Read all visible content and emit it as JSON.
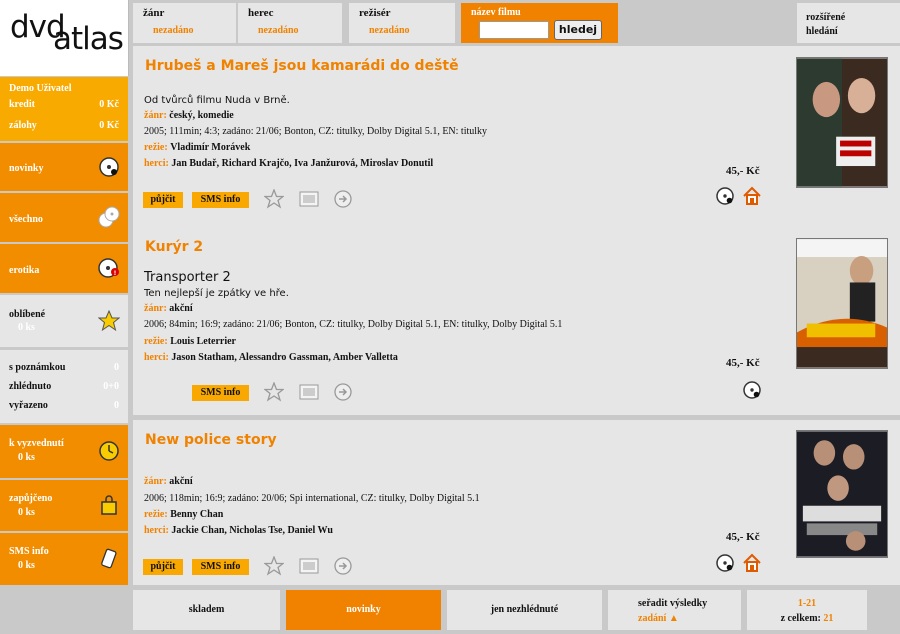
{
  "logo": {
    "part1": "dvd",
    "part2": "atlas"
  },
  "filters": [
    {
      "label": "žánr",
      "value": "nezadáno"
    },
    {
      "label": "herec",
      "value": "nezadáno"
    },
    {
      "label": "režisér",
      "value": "nezadáno"
    }
  ],
  "title_filter": {
    "label": "název filmu",
    "input_value": "",
    "button": "hledej"
  },
  "advanced": {
    "line1": "rozšířené",
    "line2": "hledání"
  },
  "user": {
    "name": "Demo Uživatel",
    "credit_label": "kredit",
    "credit_value": "0 Kč",
    "deposit_label": "zálohy",
    "deposit_value": "0 Kč"
  },
  "nav": {
    "new": "novinky",
    "all": "všechno",
    "erotic": "erotika",
    "fav": "oblíbené",
    "fav_count": "0 ks"
  },
  "stats": [
    {
      "label": "s poznámkou",
      "value": "0"
    },
    {
      "label": "zhlédnuto",
      "value": "0+0"
    },
    {
      "label": "vyřazeno",
      "value": "0"
    }
  ],
  "pickup": {
    "label": "k vyzvednutí",
    "count": "0 ks"
  },
  "borrowed": {
    "label": "zapůjčeno",
    "count": "0 ks"
  },
  "sms": {
    "label": "SMS info",
    "count": "0 ks"
  },
  "labels": {
    "genre": "žánr:",
    "director": "režie:",
    "actors": "herci:",
    "rent": "půjčit",
    "sms": "SMS info"
  },
  "movies": [
    {
      "title": "Hrubeš a Mareš jsou kamarádi do deště",
      "subtitle": "",
      "desc": "Od tvůrců filmu Nuda v Brně.",
      "genre": "český, komedie",
      "info": "2005; 111min; 4:3; zadáno: 21/06; Bonton, CZ: titulky, Dolby Digital 5.1, EN: titulky",
      "director": "Vladimír Morávek",
      "actors": "Jan Budař, Richard Krajčo, Iva Janžurová, Miroslav Donutil",
      "price": "45,- Kč"
    },
    {
      "title": "Kurýr 2",
      "subtitle": "Transporter 2",
      "desc": "Ten nejlepší je zpátky ve hře.",
      "genre": "akční",
      "info": "2006; 84min; 16:9; zadáno: 21/06; Bonton, CZ: titulky, Dolby Digital 5.1, EN: titulky, Dolby Digital 5.1",
      "director": "Louis Leterrier",
      "actors": "Jason Statham, Alessandro Gassman, Amber Valletta",
      "price": "45,- Kč"
    },
    {
      "title": "New police story",
      "subtitle": "",
      "desc": "",
      "genre": "akční",
      "info": "2006; 118min; 16:9; zadáno: 20/06; Spi international, CZ: titulky, Dolby Digital 5.1",
      "director": "Benny Chan",
      "actors": "Jackie Chan, Nicholas Tse, Daniel Wu",
      "price": "45,- Kč"
    }
  ],
  "bottom": {
    "stock": "skladem",
    "new": "novinky",
    "unseen": "jen nezhlédnuté",
    "sort_label": "seřadit výsledky",
    "sort_value": "zadání ▲",
    "range": "1-21",
    "total_label": "z celkem:",
    "total": "21"
  },
  "colors": {
    "accent": "#f08200",
    "button": "#f8a800",
    "panel": "#e6e6e6"
  }
}
